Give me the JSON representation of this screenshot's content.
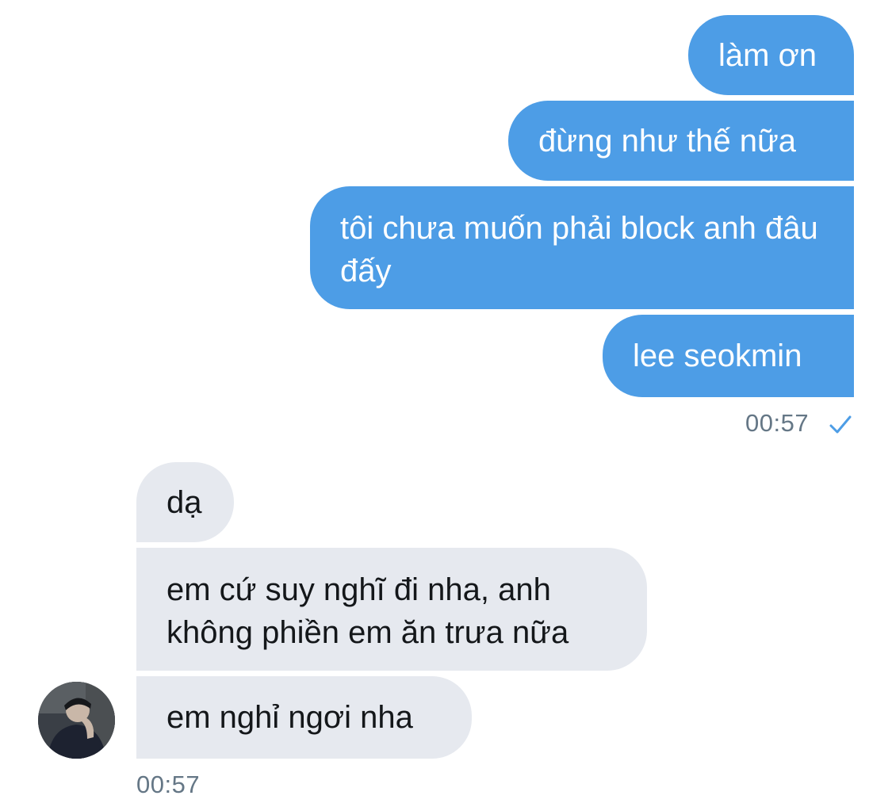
{
  "conversation": {
    "sent": [
      {
        "text": "làm ơn"
      },
      {
        "text": "đừng như thế nữa"
      },
      {
        "text": "tôi chưa muốn phải block anh đâu đấy"
      },
      {
        "text": "lee seokmin"
      }
    ],
    "sent_time": "00:57",
    "sent_status_icon": "check-icon",
    "received": [
      {
        "text": "dạ"
      },
      {
        "text": "em cứ suy nghĩ đi nha, anh không phiền em ăn trưa nữa"
      },
      {
        "text": "em nghỉ ngơi nha"
      }
    ],
    "received_time": "00:57",
    "sender_avatar_icon": "avatar"
  },
  "colors": {
    "outgoing_bubble": "#4d9de6",
    "incoming_bubble": "#e6e9ef",
    "timestamp": "#657786",
    "read_check": "#4d9de6"
  }
}
